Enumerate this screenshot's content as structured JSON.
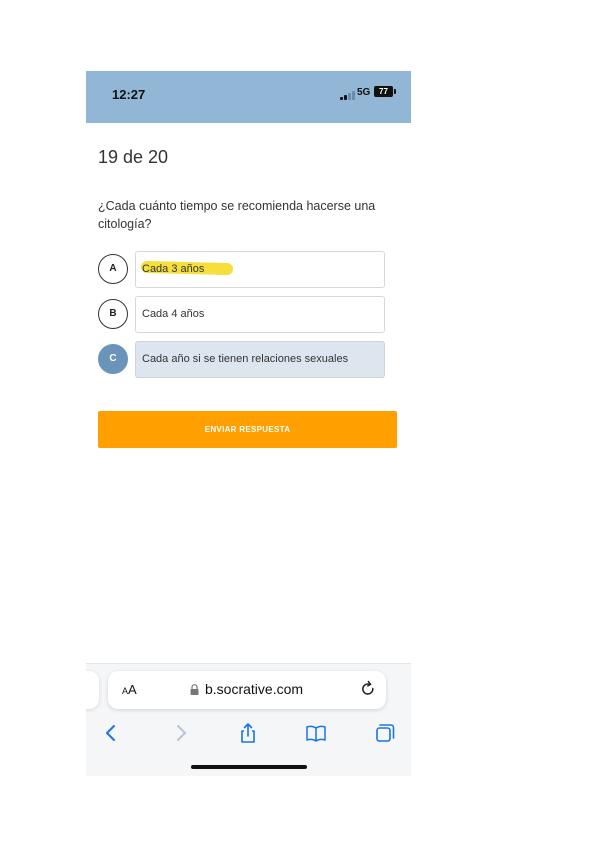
{
  "status_bar": {
    "time": "12:27",
    "network": "5G",
    "battery": "77"
  },
  "quiz": {
    "progress": "19 de 20",
    "question": "¿Cada cuánto tiempo se recomienda hacerse una citología?",
    "answers": [
      {
        "letter": "A",
        "text": "Cada 3 años",
        "selected": false,
        "highlighted": true
      },
      {
        "letter": "B",
        "text": "Cada 4 años",
        "selected": false,
        "highlighted": false
      },
      {
        "letter": "C",
        "text": "Cada año si se tienen relaciones sexuales",
        "selected": true,
        "highlighted": false
      }
    ],
    "submit_label": "ENVIAR RESPUESTA"
  },
  "browser": {
    "text_size_label_small": "A",
    "text_size_label_large": "A",
    "domain": "b.socrative.com",
    "icons": [
      "reload-icon",
      "back-icon",
      "forward-icon",
      "share-icon",
      "bookmarks-icon",
      "tabs-icon"
    ]
  },
  "colors": {
    "status_bar_bg": "#92b6d5",
    "accent_blue": "#6b94ba",
    "selected_bg": "#dde6ef",
    "submit_orange": "#ff9f00",
    "highlight_yellow": "#f6dd2f",
    "ios_blue": "#1a73e8"
  }
}
